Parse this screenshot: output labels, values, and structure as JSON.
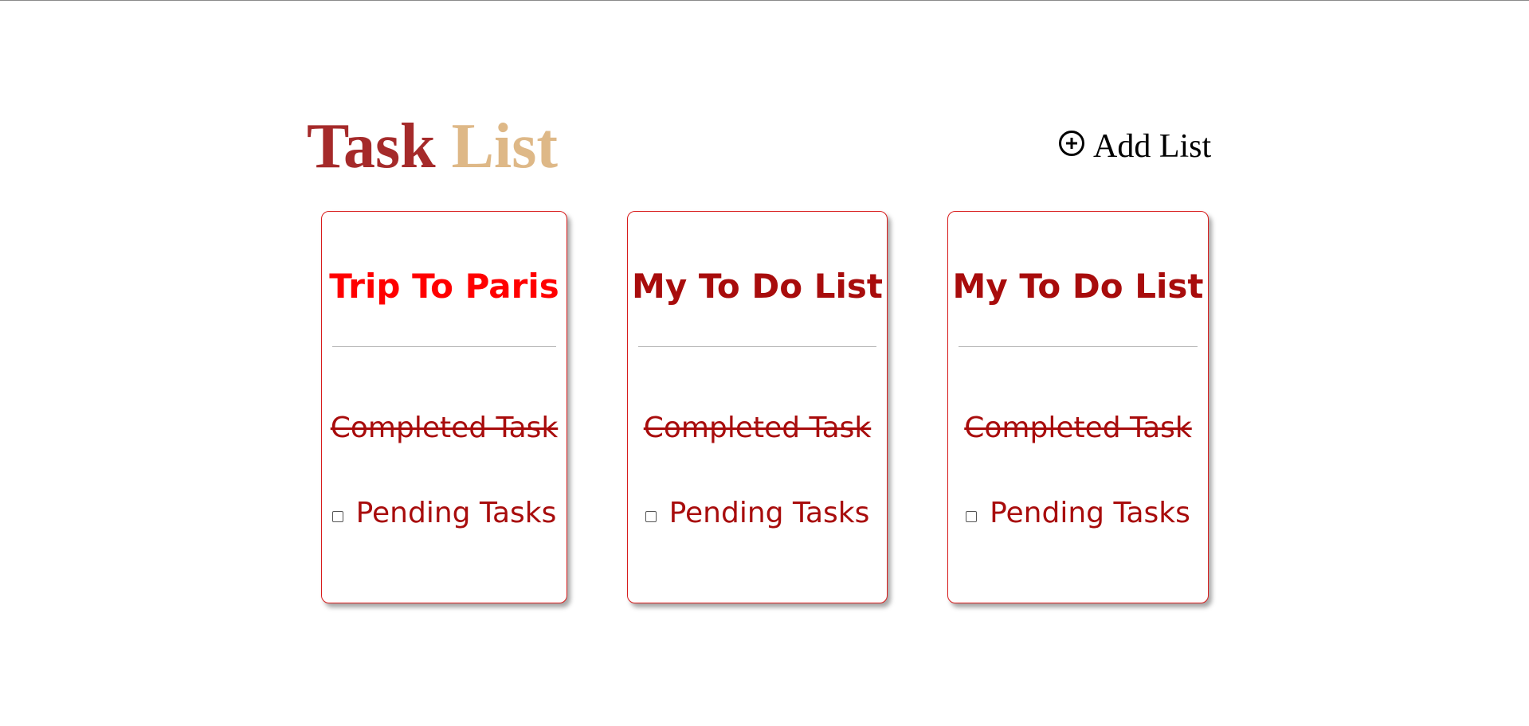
{
  "header": {
    "title_part1": "Task",
    "title_part2": "List",
    "add_list_label": "Add List",
    "add_list_icon": "plus-circle-icon"
  },
  "colors": {
    "title_part1": "#a52a2a",
    "title_part2": "#deb887",
    "card_border": "#d81b1b",
    "active_card_title": "#ff0000",
    "card_title": "#a80c0c",
    "task_text": "#a80c0c"
  },
  "lists": [
    {
      "title": "Trip To Paris",
      "completed_task": "Completed Task",
      "pending_task": "Pending Tasks",
      "pending_checked": false
    },
    {
      "title": "My To Do List",
      "completed_task": "Completed Task",
      "pending_task": "Pending Tasks",
      "pending_checked": false
    },
    {
      "title": "My To Do List",
      "completed_task": "Completed Task",
      "pending_task": "Pending Tasks",
      "pending_checked": false
    }
  ]
}
